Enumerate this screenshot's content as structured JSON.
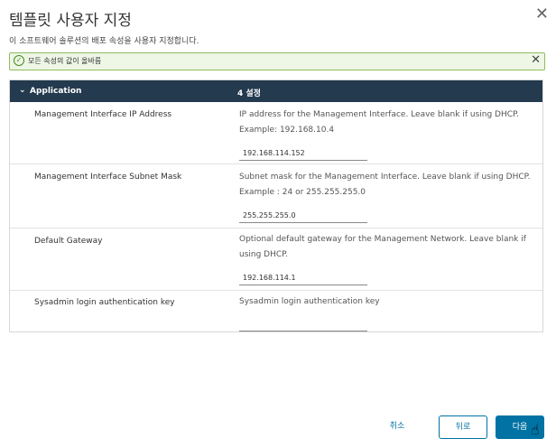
{
  "dialog": {
    "title": "템플릿 사용자 지정",
    "subtitle": "이 소프트웨어 솔루션의 배포 속성을 사용자 지정합니다.",
    "close_glyph": "✕"
  },
  "banner": {
    "message": "모든 속성의 값이 올바름",
    "check_glyph": "✓",
    "close_glyph": "✕"
  },
  "panel": {
    "section": "Application",
    "count": "4 설정",
    "chevron": "⌄",
    "rows": [
      {
        "label": "Management Interface IP Address",
        "description": "IP address for the Management Interface. Leave blank if using DHCP. Example: 192.168.10.4",
        "value": "192.168.114.152"
      },
      {
        "label": "Management Interface Subnet Mask",
        "description": "Subnet mask for the Management Interface. Leave blank if using DHCP. Example : 24 or 255.255.255.0",
        "value": "255.255.255.0"
      },
      {
        "label": "Default Gateway",
        "description": "Optional default gateway for the Management Network. Leave blank if using DHCP.",
        "value": "192.168.114.1"
      },
      {
        "label": "Sysadmin login authentication key",
        "description": "Sysadmin login authentication key",
        "value": ""
      }
    ]
  },
  "footer": {
    "cancel": "취소",
    "back": "뒤로",
    "next": "다음"
  }
}
